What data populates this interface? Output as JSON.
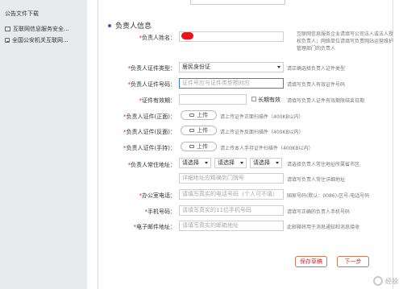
{
  "sidebar": {
    "title": "公告文件下载",
    "items": [
      {
        "label": "互联网信息服务安全..."
      },
      {
        "label": "全国公安机关互联网..."
      }
    ]
  },
  "section": {
    "title": "负责人信息"
  },
  "fields": {
    "name": {
      "label": "负责人姓名：",
      "value": "",
      "hint": "互联网信息服务企业请填写公司法人或法人授权负责人；网络单位请填写负责网站运营维护管理部门的负责人"
    },
    "id_type": {
      "label": "负责人证件类型：",
      "value": "居民身份证",
      "hint": "请正确选择负责人证件类型"
    },
    "id_number": {
      "label": "负责人证件号码：",
      "placeholder": "证件号应与证件类型相对应",
      "hint": "请填写负责人有效证件号码"
    },
    "id_validity": {
      "label": "证件有效期：",
      "longterm_label": "长期有效",
      "hint": "请填写负责人证件有效期限结束日期"
    },
    "id_front": {
      "label": "负责人证件(正面)：",
      "button": "上传",
      "hint": "请上传证件正面扫描件（400KB以内）"
    },
    "id_back": {
      "label": "负责人证件(反面)：",
      "button": "上传",
      "hint": "请上传证件反面扫描件（400KB以内）"
    },
    "id_handheld": {
      "label": "负责人证件(手持)：",
      "button": "上传",
      "hint": "请上传本人手持证件扫描件（400KB以内）"
    },
    "address": {
      "label": "负责人常住地址：",
      "sel1": "请选择",
      "sel2": "请选择",
      "sel3": "请选择",
      "hint": "请选择负责人常住地址所属省市区",
      "detail_placeholder": "详细地址应精确到门牌号",
      "detail_hint": "请填写负责人常住详细地址"
    },
    "office_phone": {
      "label": "办公室电话：",
      "placeholder": "请填写真实的电话号码（个人可不填）",
      "hint": "国家号码(默认：0086)-区号-电话号码"
    },
    "mobile": {
      "label": "手机号码：",
      "placeholder": "请填写真实的11位手机号码",
      "hint": "请填写正确的负责人手机号码"
    },
    "email": {
      "label": "电子邮件地址：",
      "placeholder": "请填写真实的邮箱地址",
      "hint": "此邮箱将用于消息通知和消息接收"
    }
  },
  "buttons": {
    "save": "保存草稿",
    "next": "下一步"
  },
  "watermark": "经验"
}
